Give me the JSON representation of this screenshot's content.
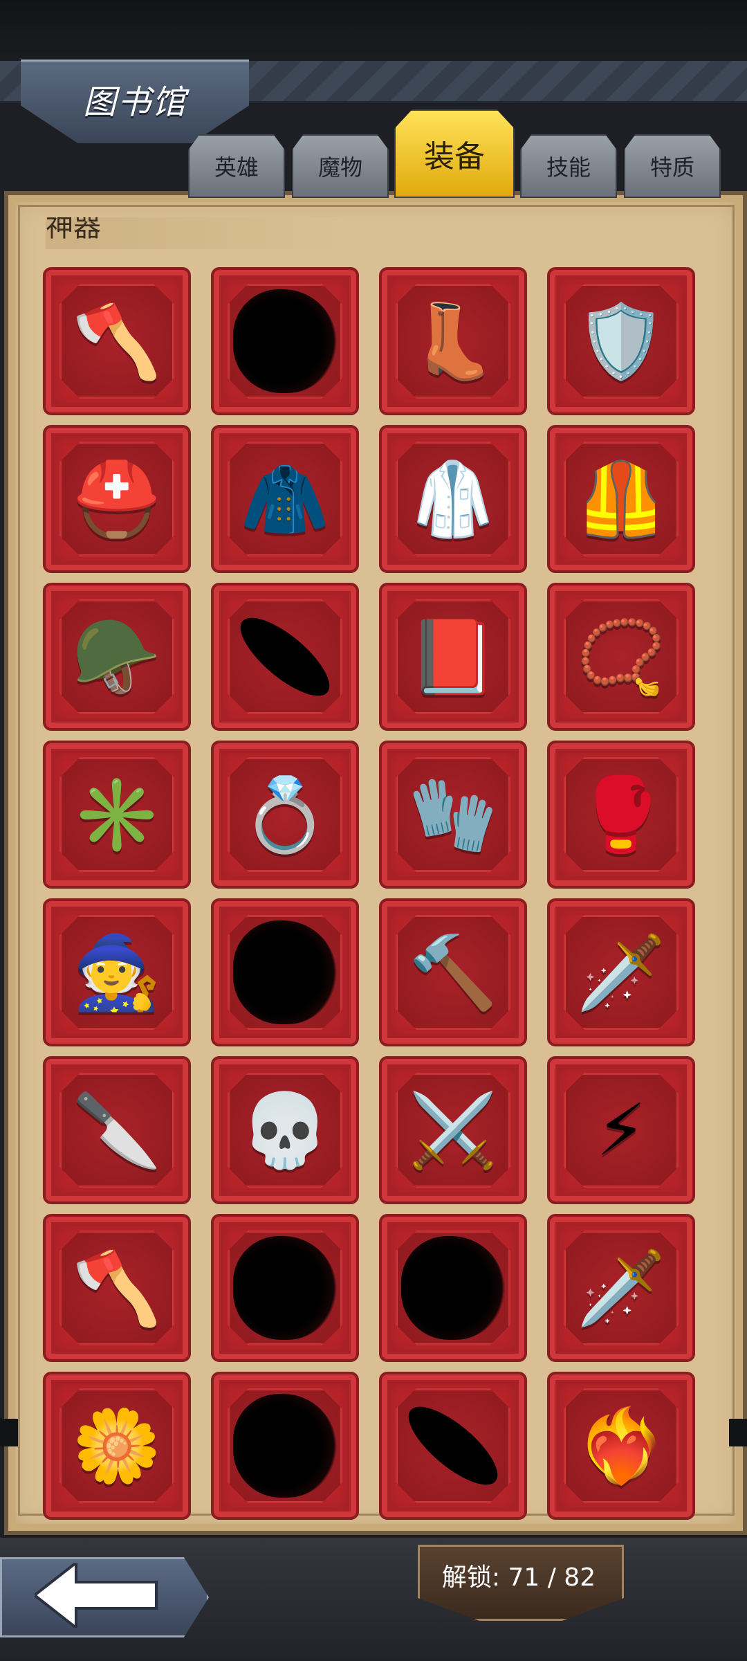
{
  "header": {
    "title": "图书馆"
  },
  "tabs": [
    {
      "label": "英雄",
      "active": false
    },
    {
      "label": "魔物",
      "active": false
    },
    {
      "label": "装备",
      "active": true
    },
    {
      "label": "技能",
      "active": false
    },
    {
      "label": "特质",
      "active": false
    }
  ],
  "section": {
    "label": "神器"
  },
  "items": [
    {
      "icon": "golden-winged-axe-icon",
      "glyph": "🪓",
      "locked": false
    },
    {
      "icon": "locked-silhouette-icon",
      "glyph": "",
      "locked": true
    },
    {
      "icon": "winged-boots-icon",
      "glyph": "👢",
      "locked": false
    },
    {
      "icon": "lightning-shield-icon",
      "glyph": "🛡️",
      "locked": false
    },
    {
      "icon": "golden-hood-helmet-icon",
      "glyph": "⛑️",
      "locked": false
    },
    {
      "icon": "royal-cape-icon",
      "glyph": "🧥",
      "locked": false
    },
    {
      "icon": "cloak-icon",
      "glyph": "🥼",
      "locked": false
    },
    {
      "icon": "green-armor-icon",
      "glyph": "🦺",
      "locked": false
    },
    {
      "icon": "winged-knight-helmet-icon",
      "glyph": "🪖",
      "locked": false
    },
    {
      "icon": "locked-silhouette-icon",
      "glyph": "",
      "locked": true
    },
    {
      "icon": "red-tome-icon",
      "glyph": "📕",
      "locked": false
    },
    {
      "icon": "ruby-pendant-icon",
      "glyph": "📿",
      "locked": false
    },
    {
      "icon": "gem-scepter-icon",
      "glyph": "✳️",
      "locked": false
    },
    {
      "icon": "jeweled-ring-icon",
      "glyph": "💍",
      "locked": false
    },
    {
      "icon": "frost-gauntlet-icon",
      "glyph": "🧤",
      "locked": false
    },
    {
      "icon": "golden-gauntlet-icon",
      "glyph": "🥊",
      "locked": false
    },
    {
      "icon": "wizard-hat-icon",
      "glyph": "🧙",
      "locked": false
    },
    {
      "icon": "locked-silhouette-icon",
      "glyph": "",
      "locked": true
    },
    {
      "icon": "war-hammer-icon",
      "glyph": "🔨",
      "locked": false
    },
    {
      "icon": "crystal-sword-icon",
      "glyph": "🗡️",
      "locked": false
    },
    {
      "icon": "poison-dagger-icon",
      "glyph": "🔪",
      "locked": false
    },
    {
      "icon": "skull-hook-icon",
      "glyph": "💀",
      "locked": false
    },
    {
      "icon": "steel-spear-icon",
      "glyph": "⚔️",
      "locked": false
    },
    {
      "icon": "lightning-spear-icon",
      "glyph": "⚡",
      "locked": false
    },
    {
      "icon": "crimson-battle-axe-icon",
      "glyph": "🪓",
      "locked": false
    },
    {
      "icon": "locked-silhouette-icon",
      "glyph": "",
      "locked": true
    },
    {
      "icon": "locked-silhouette-icon",
      "glyph": "",
      "locked": true
    },
    {
      "icon": "blood-greatsword-icon",
      "glyph": "🗡️",
      "locked": false
    },
    {
      "icon": "flower-staff-icon",
      "glyph": "🌼",
      "locked": false
    },
    {
      "icon": "locked-silhouette-icon",
      "glyph": "",
      "locked": true
    },
    {
      "icon": "locked-silhouette-icon",
      "glyph": "",
      "locked": true
    },
    {
      "icon": "flaming-heart-icon",
      "glyph": "❤️‍🔥",
      "locked": false
    }
  ],
  "footer": {
    "unlock_text": "解锁: 71 / 82"
  },
  "colors": {
    "tab_active": "#f2c321",
    "cell_red": "#b8242a",
    "parchment": "#d9bf93"
  }
}
